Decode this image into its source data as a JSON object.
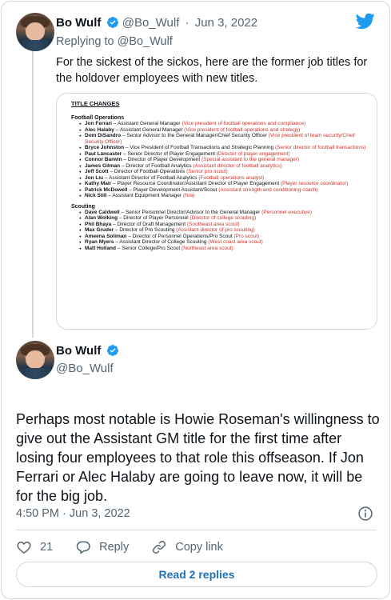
{
  "tweet1": {
    "name": "Bo Wulf",
    "handle": "@Bo_Wulf",
    "separator": "·",
    "date": "Jun 3, 2022",
    "replying_prefix": "Replying to",
    "replying_to": "@Bo_Wulf",
    "text": "For the sickest of the sickos, here are the former job titles for the holdover employees with new titles."
  },
  "document": {
    "title": "TITLE CHANGES",
    "sections": [
      {
        "heading": "Football Operations",
        "items": [
          {
            "name": "Jon Ferrari",
            "title": " – Assistant General Manager ",
            "former": "(Vice president of football operations and compliance)"
          },
          {
            "name": "Alec Halaby",
            "title": " – Assistant General Manager ",
            "former": "(Vice president of football operations and strategy)"
          },
          {
            "name": "Dom DiSandro",
            "title": " – Senior Advisor to the General Manager/Chief Security Officer ",
            "former": "(Vice president of team security/Chief Security Officer)"
          },
          {
            "name": "Bryce Johnston",
            "title": " – Vice President of Football Transactions and Strategic Planning ",
            "former": "(Senior director of football transactions)"
          },
          {
            "name": "Paul Lancaster",
            "title": " – Senior Director of Player Engagement ",
            "former": "(Director of player engagement)"
          },
          {
            "name": "Connor Barwin",
            "title": " – Director of Player Development ",
            "former": "(Special assistant to the general manager)"
          },
          {
            "name": "James Gilman",
            "title": " – Director of Football Analytics ",
            "former": "(Assistant director of football analytics)"
          },
          {
            "name": "Jeff Scott",
            "title": " – Director of Football Operations ",
            "former": "(Senior pro scout)"
          },
          {
            "name": "Jon Liu",
            "title": " – Assistant Director of Football Analytics ",
            "former": "(Football operations analyst)"
          },
          {
            "name": "Kathy Mair",
            "title": " – Player Resource Coordinator/Assistant Director of Player Engagement ",
            "former": "(Player resource coordinator)"
          },
          {
            "name": "Patrick McDowell",
            "title": " – Player Development Assistant/Scout ",
            "former": "(Assistant strength and conditioning coach)"
          },
          {
            "name": "Nick Still",
            "title": " – Assistant Equipment Manager ",
            "former": "(N/a)"
          }
        ]
      },
      {
        "heading": "Scouting",
        "items": [
          {
            "name": "Dave Caldwell",
            "title": " – Senior Personnel Director/Advisor to the General Manager ",
            "former": "(Personnel executive)"
          },
          {
            "name": "Alan Wolking",
            "title": " – Director of Player Personnel ",
            "former": "(Director of college scouting)"
          },
          {
            "name": "Phil Bhaya",
            "title": " – Director of Draft Management ",
            "former": "(Southeast area scout)"
          },
          {
            "name": "Max Gruder",
            "title": " – Director of Pro Scouting ",
            "former": "(Assistant director of pro scouting)"
          },
          {
            "name": "Ameena Soliman",
            "title": " – Director of Personnel Operations/Pro Scout ",
            "former": "(Pro scout)"
          },
          {
            "name": "Ryan Myers",
            "title": " – Assistant Director of College Scouting ",
            "former": "(West coast area scout)"
          },
          {
            "name": "Matt Holland",
            "title": " – Senior College/Pro Scout ",
            "former": "(Northeast area scout)"
          }
        ]
      }
    ]
  },
  "tweet2": {
    "name": "Bo Wulf",
    "handle": "@Bo_Wulf",
    "text": "Perhaps most notable is Howie Roseman's willingness to give out the Assistant GM title for the first time after losing four employees to that role this offseason. If Jon Ferrari or Alec Halaby are going to leave now, it will be for the big job.",
    "time": "4:50 PM",
    "separator": "·",
    "date": "Jun 3, 2022",
    "likes": "21",
    "reply_label": "Reply",
    "copy_label": "Copy link",
    "read_replies": "Read 2 replies"
  },
  "colors": {
    "accent": "#1d9bf0",
    "muted": "#536471",
    "doc_red": "#d0342c",
    "border": "#cfd9de"
  },
  "icons": [
    "twitter-bird-icon",
    "verified-badge-icon",
    "info-icon",
    "heart-icon",
    "reply-icon",
    "link-icon"
  ]
}
